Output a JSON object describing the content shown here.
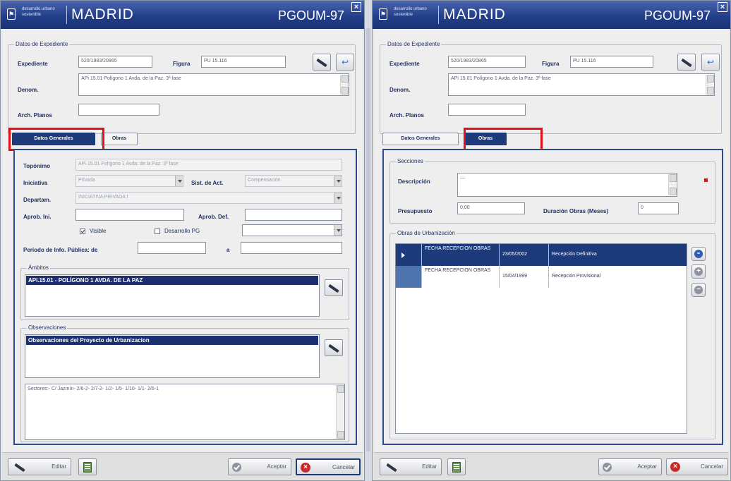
{
  "brand": {
    "small_line1": "desarrollo urbano",
    "small_line2": "sostenible",
    "city": "MADRID",
    "plan": "PGOUM-97"
  },
  "expediente": {
    "legend": "Datos de Expediente",
    "expediente_label": "Expediente",
    "expediente_value": "520/1983/20865",
    "figura_label": "Figura",
    "figura_value": "PU 15.116",
    "denom_label": "Denom.",
    "denom_value": "APi 15.01 Polígono 1 Avda. de la Paz. 3ª fase",
    "arch_label": "Arch. Planos",
    "arch_value": ""
  },
  "tabs": {
    "general": "Datos Generales",
    "obras": "Obras"
  },
  "general": {
    "toponimo_label": "Topónimo",
    "toponimo_value": "APi 15.01 Polígono 1 Avda. de la Paz. 3ª fase",
    "iniciativa_label": "Iniciativa",
    "iniciativa_value": "Privada",
    "sist_label": "Sist. de Act.",
    "sist_value": "Compensación",
    "departam_label": "Departam.",
    "departam_value": "INICIATIVA PRIVADA I",
    "aprob_ini_label": "Aprob. Ini.",
    "aprob_ini_value": "",
    "aprob_def_label": "Aprob. Def.",
    "aprob_def_value": "",
    "visible_label": "Visible",
    "visible_checked": true,
    "desarrollo_label": "Desarrollo PG",
    "desarrollo_checked": false,
    "periodo_label": "Periodo de Info. Pública: de",
    "periodo_from": "",
    "periodo_a_label": "a",
    "periodo_to": "",
    "ambitos_legend": "Ámbitos",
    "ambitos_item": "API.15.01 - POLÍGONO 1 AVDA. DE LA PAZ",
    "observ_legend": "Observaciones",
    "observ_item": "Observaciones del Proyecto de Urbanizacion",
    "observ_text": "Sectores:- C/ Jazmín- 2/6-2- 2/7-2- 1/2- 1/5- 1/10- 1/1- 2/6-1"
  },
  "obras": {
    "secciones_legend": "Secciones",
    "descripcion_label": "Descripción",
    "descripcion_value": "—",
    "presupuesto_label": "Presupuesto",
    "presupuesto_value": "0,00",
    "duracion_label": "Duración Obras (Meses)",
    "duracion_value": "0",
    "urb_legend": "Obras de Urbanización",
    "rows": [
      {
        "tipo": "FECHA RECEPCION OBRAS",
        "fecha": "23/05/2002",
        "desc": "Recepción Definitiva"
      },
      {
        "tipo": "FECHA RECEPCION OBRAS",
        "fecha": "15/04/1999",
        "desc": "Recepción Provisional"
      }
    ]
  },
  "footer": {
    "editar": "Editar",
    "aceptar": "Aceptar",
    "cancelar": "Cancelar"
  },
  "colors": {
    "brand_blue": "#1d3a7a",
    "highlight_red": "#e0101b",
    "cancel_red": "#c92a2a"
  }
}
